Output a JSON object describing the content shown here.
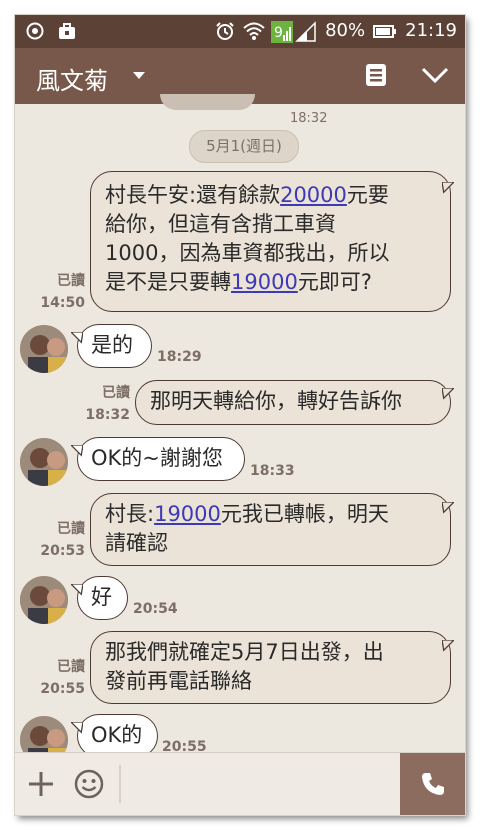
{
  "status_bar": {
    "battery_percent": "80%",
    "time": "21:19",
    "signal_badge": "9"
  },
  "header": {
    "contact_name": "風文菊"
  },
  "chat": {
    "prev_time": "18:32",
    "date_label": "5月1(週日)",
    "messages": [
      {
        "direction": "out",
        "parts": [
          "村長午安:還有餘款",
          "20000",
          "元要\n給你，但這有含揹工車資\n1000，因為車資都我出，所以\n是不是只要轉",
          "19000",
          "元即可?"
        ],
        "read_label": "已讀",
        "time": "14:50"
      },
      {
        "direction": "in",
        "text": "是的",
        "time": "18:29"
      },
      {
        "direction": "out",
        "text": "那明天轉給你，轉好告訴你",
        "read_label": "已讀",
        "time": "18:32"
      },
      {
        "direction": "in",
        "text": "OK的~謝謝您",
        "time": "18:33"
      },
      {
        "direction": "out",
        "parts": [
          "村長:",
          "19000",
          "元我已轉帳，明天\n請確認"
        ],
        "read_label": "已讀",
        "time": "20:53"
      },
      {
        "direction": "in",
        "text": "好",
        "time": "20:54"
      },
      {
        "direction": "out",
        "text": "那我們就確定5月7日出發，出\n發前再電話聯絡",
        "read_label": "已讀",
        "time": "20:55"
      },
      {
        "direction": "in",
        "text": "OK的",
        "time": "20:55"
      }
    ]
  },
  "icons": {
    "status_left": [
      "record-icon",
      "briefcase-icon"
    ],
    "status_right": [
      "alarm-icon",
      "wifi-icon",
      "signal-icon",
      "battery-icon"
    ],
    "header": [
      "note-icon",
      "chevron-down-icon"
    ],
    "input": [
      "plus-icon",
      "smiley-icon",
      "phone-icon"
    ]
  },
  "colors": {
    "status_bar": "#5c4236",
    "header": "#77584a",
    "chat_bg": "#ece7df",
    "bubble_out": "#ebe3d7",
    "bubble_in": "#ffffff",
    "link": "#3d3ab5",
    "call_button": "#8c6c5e"
  }
}
